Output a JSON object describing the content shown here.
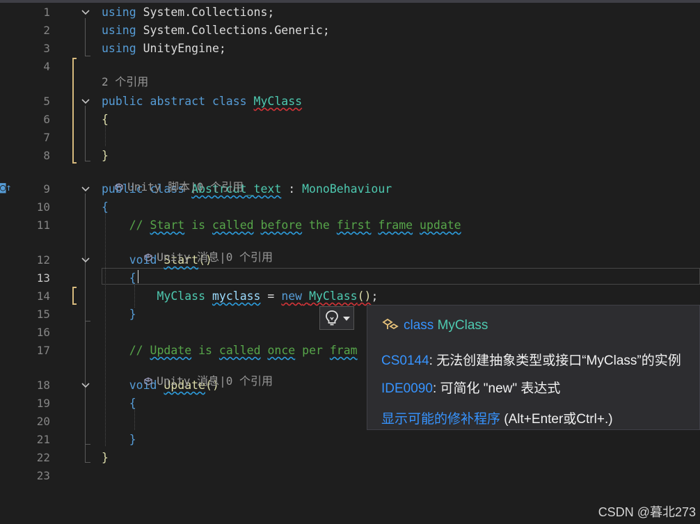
{
  "editor": {
    "lines": [
      {
        "num": "1",
        "parts": [
          [
            "kw",
            "using"
          ],
          [
            "pl",
            " System.Collections;"
          ]
        ]
      },
      {
        "num": "2",
        "parts": [
          [
            "kw",
            "using"
          ],
          [
            "pl",
            " System.Collections.Generic;"
          ]
        ]
      },
      {
        "num": "3",
        "parts": [
          [
            "kw",
            "using"
          ],
          [
            "pl",
            " UnityEngine;"
          ]
        ]
      },
      {
        "num": "4",
        "parts": []
      },
      {
        "num": "5",
        "parts": [
          [
            "kw",
            "public abstract class "
          ],
          [
            "ty squig",
            "MyClass"
          ]
        ]
      },
      {
        "num": "6",
        "parts": [
          [
            "me",
            "{"
          ]
        ]
      },
      {
        "num": "7",
        "parts": []
      },
      {
        "num": "8",
        "parts": [
          [
            "me",
            "}"
          ]
        ]
      },
      {
        "num": "9",
        "parts": [
          [
            "kw",
            "public class "
          ],
          [
            "ty squigg",
            "Abstrcut_text"
          ],
          [
            "pl",
            " : "
          ],
          [
            "ty",
            "MonoBehaviour"
          ]
        ]
      },
      {
        "num": "10",
        "parts": [
          [
            "kw",
            "{"
          ]
        ]
      },
      {
        "num": "11",
        "parts": [
          [
            "cm",
            "    // "
          ],
          [
            "cm squigg",
            "Start"
          ],
          [
            "cm",
            " is "
          ],
          [
            "cm squigg",
            "called"
          ],
          [
            "cm",
            " "
          ],
          [
            "cm squigg",
            "before"
          ],
          [
            "cm",
            " the "
          ],
          [
            "cm squigg",
            "first"
          ],
          [
            "cm",
            " "
          ],
          [
            "cm squigg",
            "frame"
          ],
          [
            "cm",
            " "
          ],
          [
            "cm squigg",
            "update"
          ]
        ]
      },
      {
        "num": "12",
        "parts": [
          [
            "kw",
            "    void "
          ],
          [
            "me squigg",
            "Start"
          ],
          [
            "me",
            "()"
          ]
        ]
      },
      {
        "num": "13",
        "parts": [
          [
            "kw",
            "    {"
          ]
        ]
      },
      {
        "num": "14",
        "parts": [
          [
            "ty",
            "        MyClass "
          ],
          [
            "id squigg",
            "myclass"
          ],
          [
            "pl",
            " = "
          ],
          [
            "kw squig",
            "new"
          ],
          [
            "pl squig",
            " "
          ],
          [
            "ty squig",
            "MyClass"
          ],
          [
            "me squig",
            "()"
          ],
          [
            "pl",
            ";"
          ]
        ]
      },
      {
        "num": "15",
        "parts": [
          [
            "kw",
            "    }"
          ]
        ]
      },
      {
        "num": "16",
        "parts": []
      },
      {
        "num": "17",
        "parts": [
          [
            "cm",
            "    // "
          ],
          [
            "cm squigg",
            "Update"
          ],
          [
            "cm",
            " is "
          ],
          [
            "cm squigg",
            "called"
          ],
          [
            "cm",
            " "
          ],
          [
            "cm squigg",
            "once"
          ],
          [
            "cm",
            " per "
          ],
          [
            "cm squigg",
            "fram"
          ]
        ]
      },
      {
        "num": "18",
        "parts": [
          [
            "kw",
            "    void "
          ],
          [
            "me squigg",
            "Update"
          ],
          [
            "me",
            "()"
          ]
        ]
      },
      {
        "num": "19",
        "parts": [
          [
            "kw",
            "    {"
          ]
        ]
      },
      {
        "num": "20",
        "parts": []
      },
      {
        "num": "21",
        "parts": [
          [
            "kw",
            "    }"
          ]
        ]
      },
      {
        "num": "22",
        "parts": [
          [
            "me",
            "}"
          ]
        ]
      },
      {
        "num": "23",
        "parts": []
      }
    ],
    "active_line": "13",
    "codelens": {
      "refs_class": "2 个引用",
      "unity_script": "Unity 脚本|0 个引用",
      "unity_msg_start": "Unity 消息|0 个引用",
      "unity_msg_update": "Unity 消息|0 个引用"
    }
  },
  "quick_actions": {
    "icon": "lightbulb-icon",
    "title": "class MyClass",
    "title_keyword": "class",
    "title_type": "MyClass",
    "items": [
      {
        "code": "CS0144",
        "text": ": 无法创建抽象类型或接口“MyClass”的实例"
      },
      {
        "code": "IDE0090",
        "text": ": 可简化 \"new\" 表达式"
      }
    ],
    "fix_link": "显示可能的修补程序",
    "fix_shortcut": " (Alt+Enter或Ctrl+.)"
  },
  "watermark": "CSDN @暮北273",
  "colors": {
    "background": "#1e1e1e",
    "keyword": "#569cd6",
    "type": "#4ec9b0",
    "comment": "#57a64a",
    "error_squiggle": "#d13438",
    "popup_bg": "#2d2d30"
  }
}
